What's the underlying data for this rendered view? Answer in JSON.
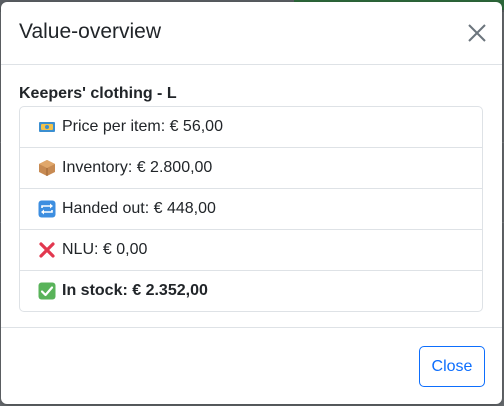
{
  "modal": {
    "title": "Value-overview",
    "close_icon": "close-x-icon",
    "item_name": "Keepers' clothing - L",
    "rows": [
      {
        "icon": "money-emoji-icon",
        "text": "Price per item: € 56,00",
        "bold": false
      },
      {
        "icon": "package-emoji-icon",
        "text": "Inventory: € 2.800,00",
        "bold": false
      },
      {
        "icon": "repeat-emoji-icon",
        "text": "Handed out: € 448,00",
        "bold": false
      },
      {
        "icon": "cross-mark-emoji-icon",
        "text": "NLU: € 0,00",
        "bold": false
      },
      {
        "icon": "check-mark-emoji-icon",
        "text": "In stock: € 2.352,00",
        "bold": true
      }
    ],
    "footer": {
      "close_label": "Close"
    }
  },
  "colors": {
    "primary": "#0d6efd",
    "border": "#dee2e6",
    "text": "#212529",
    "backdrop": "#6b6f73"
  }
}
